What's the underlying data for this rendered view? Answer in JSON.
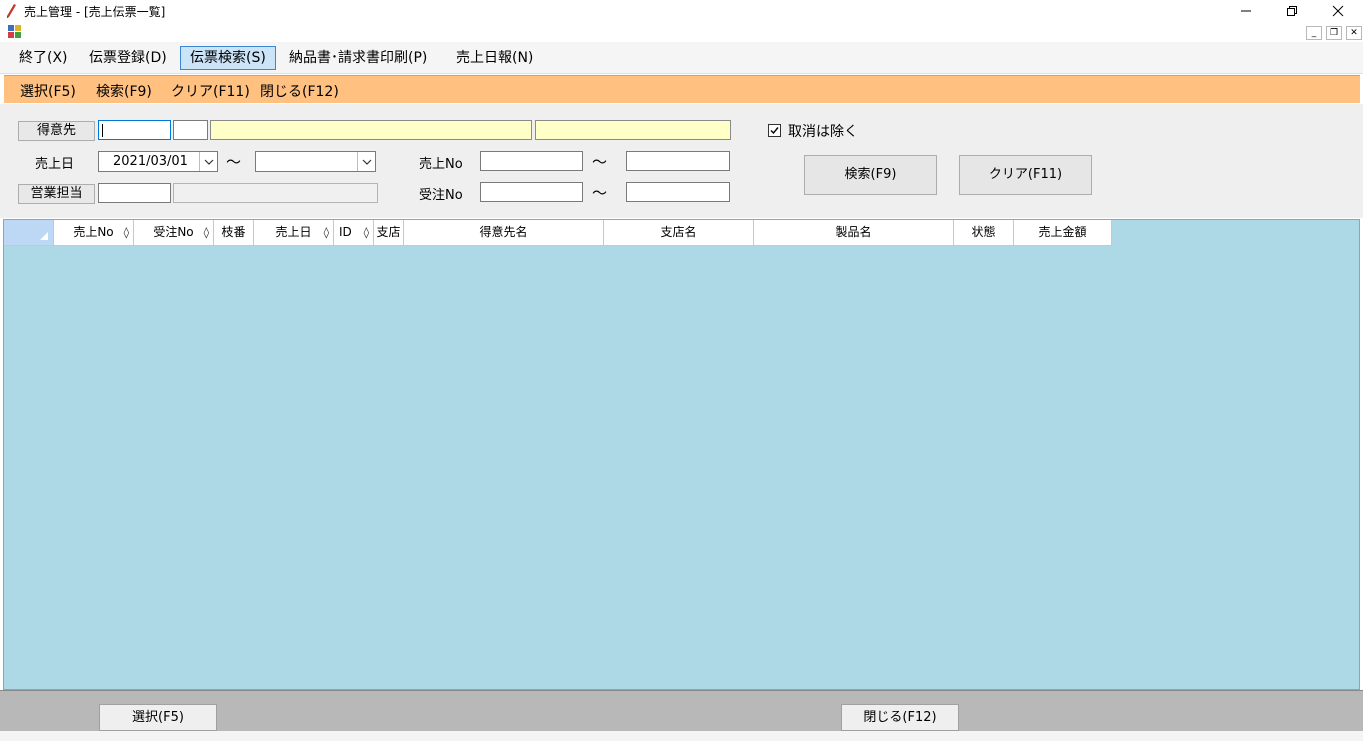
{
  "window": {
    "title": "売上管理 - [売上伝票一覧]"
  },
  "menu": [
    {
      "label": "終了(X)"
    },
    {
      "label": "伝票登録(D)"
    },
    {
      "label": "伝票検索(S)"
    },
    {
      "label": "納品書･請求書印刷(P)"
    },
    {
      "label": "売上日報(N)"
    }
  ],
  "toolstrip": [
    {
      "label": "選択(F5)"
    },
    {
      "label": "検索(F9)"
    },
    {
      "label": "クリア(F11)"
    },
    {
      "label": "閉じる(F12)"
    }
  ],
  "search": {
    "customer_label": "得意先",
    "sales_date_label": "売上日",
    "sales_date_from": "2021/03/01",
    "sales_date_to": "",
    "tilde": "～",
    "staff_label": "営業担当",
    "sales_no_label": "売上No",
    "order_no_label": "受注No",
    "exclude_cancel_label": "取消は除く",
    "exclude_cancel_checked": true,
    "search_button": "検索(F9)",
    "clear_button": "クリア(F11)"
  },
  "grid": {
    "columns": [
      {
        "label": "",
        "sortable": false
      },
      {
        "label": "売上No",
        "sortable": true
      },
      {
        "label": "受注No",
        "sortable": true
      },
      {
        "label": "枝番",
        "sortable": false
      },
      {
        "label": "売上日",
        "sortable": true
      },
      {
        "label": "ID",
        "sortable": true
      },
      {
        "label": "支店",
        "sortable": false
      },
      {
        "label": "得意先名",
        "sortable": false
      },
      {
        "label": "支店名",
        "sortable": false
      },
      {
        "label": "製品名",
        "sortable": false
      },
      {
        "label": "状態",
        "sortable": false
      },
      {
        "label": "売上金額",
        "sortable": false
      }
    ],
    "sort_glyph": "◊"
  },
  "footer": {
    "select_button": "選択(F5)",
    "close_button": "閉じる(F12)"
  }
}
